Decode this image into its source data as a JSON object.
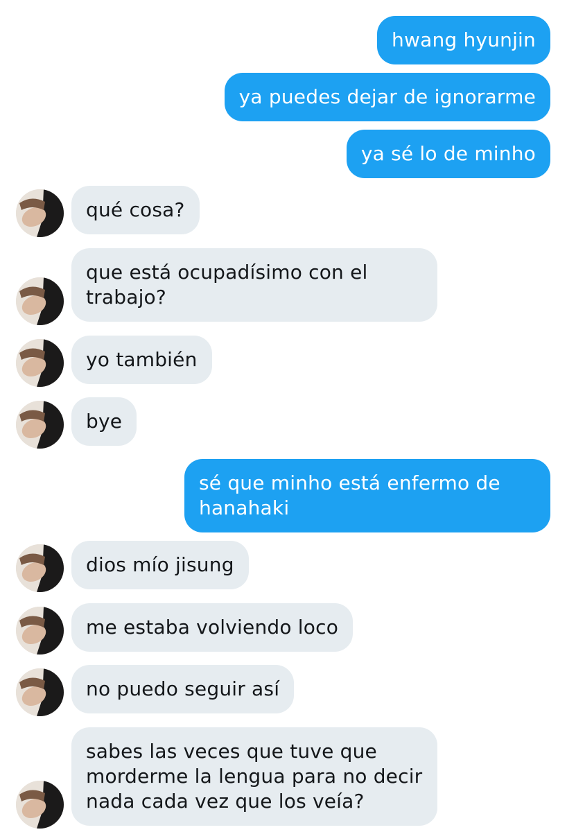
{
  "conversation": {
    "messages": [
      {
        "direction": "sent",
        "text": "hwang hyunjin"
      },
      {
        "direction": "sent",
        "text": "ya puedes dejar de ignorarme"
      },
      {
        "direction": "sent",
        "text": "ya sé lo de minho"
      },
      {
        "direction": "received",
        "text": "qué cosa?"
      },
      {
        "direction": "received",
        "text": "que está ocupadísimo con el trabajo?"
      },
      {
        "direction": "received",
        "text": "yo también"
      },
      {
        "direction": "received",
        "text": "bye"
      },
      {
        "direction": "sent",
        "text": "sé que minho está enfermo de hanahaki"
      },
      {
        "direction": "received",
        "text": "dios mío jisung"
      },
      {
        "direction": "received",
        "text": "me estaba volviendo loco"
      },
      {
        "direction": "received",
        "text": "no puedo seguir así"
      },
      {
        "direction": "received",
        "text": "sabes las veces que tuve que morderme la lengua para no decir nada cada vez que los veía?"
      }
    ]
  },
  "colors": {
    "sent_bubble": "#1da1f2",
    "received_bubble": "#e6ecf0"
  },
  "icons": {
    "avatar": "contact-avatar-photo"
  }
}
